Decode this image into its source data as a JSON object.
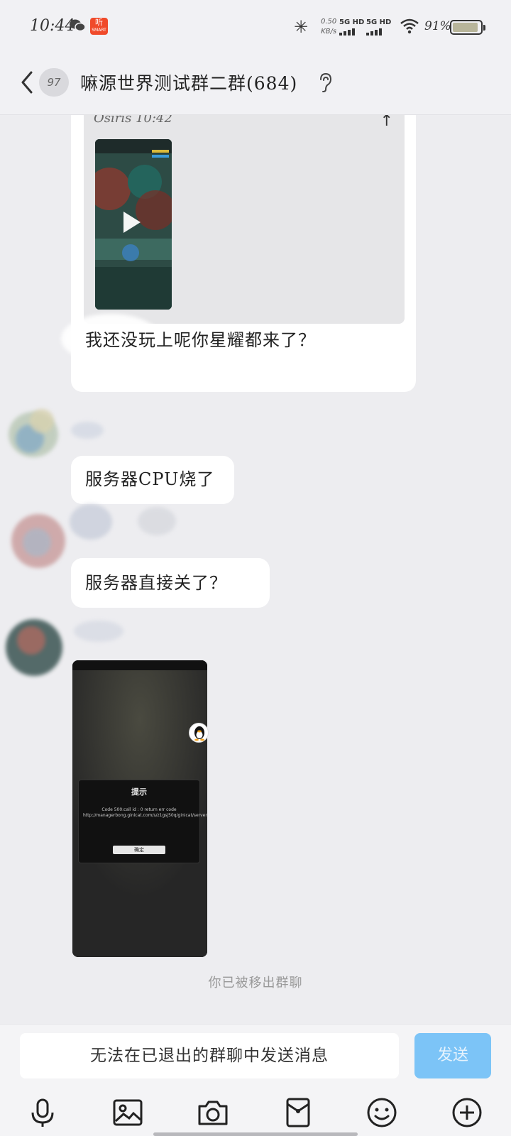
{
  "status_bar": {
    "time": "10:44",
    "app_badge": "听",
    "app_badge_sub": "SMART",
    "speed_value": "0.50",
    "speed_unit": "KB/s",
    "sim1": "5G HD",
    "sim2": "5G HD",
    "battery": "91%"
  },
  "header": {
    "unread_count": "97",
    "title": "嘛源世界测试群二群(684)"
  },
  "messages": {
    "reply_author": "Osiris 10:42",
    "msg1_text": "我还没玩上呢你星耀都来了？",
    "msg2_text": "服务器CPU烧了",
    "msg3_text": "服务器直接关了？",
    "screenshot_dialog_title": "提示",
    "screenshot_dialog_body": "Code 500:call id : 0 return err code http://managerbong.ginicat.com/s/z1gsj50q/ginicat/server/",
    "screenshot_dialog_button": "确定"
  },
  "system_notice": "你已被移出群聊",
  "input_bar": {
    "placeholder": "无法在已退出的群聊中发送消息",
    "send_label": "发送"
  },
  "toolbar_icons": [
    "mic-icon",
    "image-icon",
    "camera-icon",
    "red-packet-icon",
    "emoji-icon",
    "plus-icon"
  ],
  "colors": {
    "send_button": "#7cc4f7",
    "background": "#ededf0",
    "bubble": "#ffffff"
  }
}
